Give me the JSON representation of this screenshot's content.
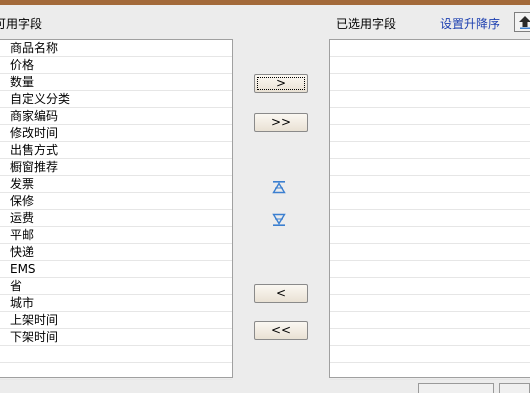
{
  "header": {
    "available_title": "可用字段",
    "selected_title": "已选用字段",
    "sort_link": "设置升降序"
  },
  "available_fields": [
    "商品名称",
    "价格",
    "数量",
    "自定义分类",
    "商家编码",
    "修改时间",
    "出售方式",
    "橱窗推荐",
    "发票",
    "保修",
    "运费",
    "平邮",
    "快递",
    "EMS",
    "省",
    "城市",
    "上架时间",
    "下架时间",
    "",
    ""
  ],
  "selected_fields": [
    "",
    "",
    "",
    "",
    "",
    "",
    "",
    "",
    "",
    "",
    "",
    "",
    "",
    "",
    "",
    "",
    "",
    "",
    "",
    ""
  ],
  "buttons": {
    "add": ">",
    "add_all": ">>",
    "remove": "<",
    "remove_all": "<<"
  },
  "icons": {
    "upload": "upload-arrow-icon",
    "move_top": "move-to-top-icon",
    "move_bottom": "move-to-bottom-icon"
  },
  "colors": {
    "top_bar": "#a36a3a",
    "link": "#1c3fb0",
    "icon_blue": "#3b7fd0"
  }
}
